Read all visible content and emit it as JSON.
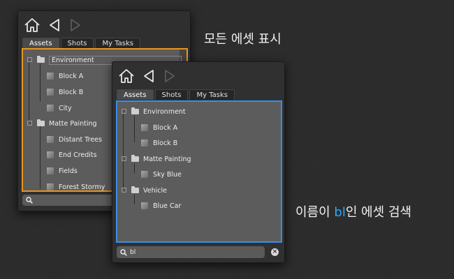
{
  "panel1": {
    "tabs": [
      "Assets",
      "Shots",
      "My Tasks"
    ],
    "tree": {
      "items": [
        {
          "label": "Environment",
          "kind": "folder"
        },
        {
          "label": "Block A",
          "kind": "asset"
        },
        {
          "label": "Block B",
          "kind": "asset"
        },
        {
          "label": "City",
          "kind": "asset"
        },
        {
          "label": "Matte Painting",
          "kind": "folder"
        },
        {
          "label": "Distant Trees",
          "kind": "asset"
        },
        {
          "label": "End Credits",
          "kind": "asset"
        },
        {
          "label": "Fields",
          "kind": "asset"
        },
        {
          "label": "Forest Stormy",
          "kind": "asset"
        }
      ]
    },
    "search_value": "",
    "highlight_color": "#e8951f"
  },
  "panel2": {
    "tabs": [
      "Assets",
      "Shots",
      "My Tasks"
    ],
    "tree": {
      "items": [
        {
          "label": "Environment",
          "kind": "folder"
        },
        {
          "label": "Block A",
          "kind": "asset"
        },
        {
          "label": "Block B",
          "kind": "asset"
        },
        {
          "label": "Matte Painting",
          "kind": "folder"
        },
        {
          "label": "Sky Blue",
          "kind": "asset"
        },
        {
          "label": "Vehicle",
          "kind": "folder"
        },
        {
          "label": "Blue Car",
          "kind": "asset"
        }
      ]
    },
    "search_value": "bl",
    "highlight_color": "#3a8ee8"
  },
  "captions": {
    "show_all": "모든 에셋 표시",
    "search_prefix": "이름이 ",
    "search_term": "bl",
    "search_suffix": "인 에셋 검색"
  },
  "icons": [
    "home-icon",
    "back-arrow-icon",
    "forward-arrow-icon",
    "folder-icon",
    "asset-cube-icon",
    "search-icon",
    "clear-icon"
  ]
}
